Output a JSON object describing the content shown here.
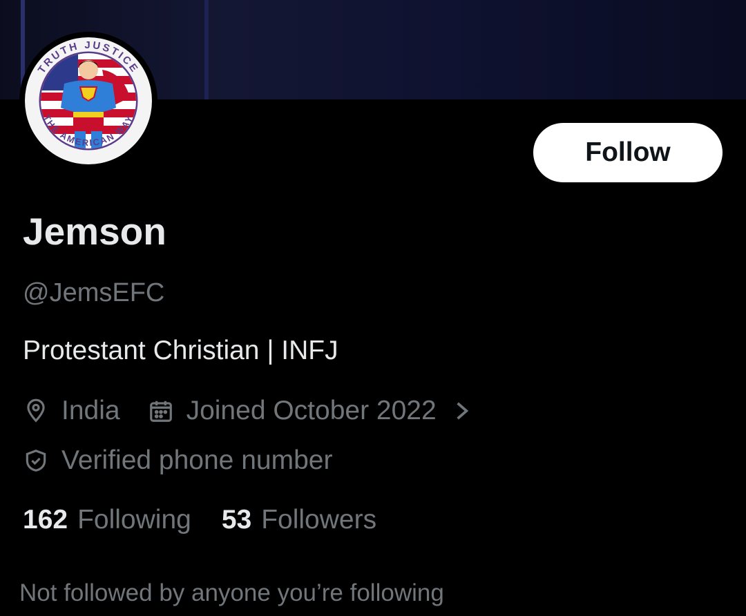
{
  "profile": {
    "name": "Jemson",
    "handle": "@JemsEFC",
    "bio": "Protestant Christian | INFJ",
    "location": "India",
    "joined": "Joined October 2022",
    "verified": "Verified phone number",
    "avatar_text_top": "TRUTH JUSTICE",
    "avatar_text_bottom": "THE AMERICAN WAY"
  },
  "actions": {
    "follow_label": "Follow"
  },
  "stats": {
    "following_count": "162",
    "following_label": "Following",
    "followers_count": "53",
    "followers_label": "Followers"
  },
  "social_context": "Not followed by anyone you’re following",
  "icons": {
    "location": "location-pin-icon",
    "calendar": "calendar-icon",
    "verified": "shield-check-icon",
    "chevron": "chevron-right-icon"
  },
  "colors": {
    "background": "#000000",
    "primary_text": "#e7e9ea",
    "secondary_text": "#71767b",
    "button_bg": "#ffffff",
    "button_text": "#0f1419"
  }
}
